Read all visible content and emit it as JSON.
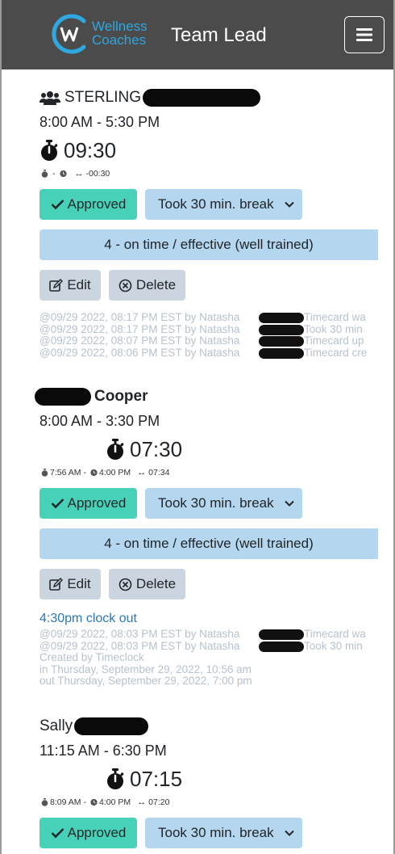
{
  "header": {
    "logo_line1": "Wellness",
    "logo_line2": "Coaches",
    "title": "Team Lead",
    "brand_color": "#2fa7e0",
    "menu_icon": "hamburger-icon"
  },
  "entries": [
    {
      "name": "STERLING",
      "name_icon": "users-icon",
      "shift": "8:00 AM - 5:30 PM",
      "duration": "09:30",
      "meta_in": "-",
      "meta_out": "",
      "meta_diff": "-00:30",
      "status": "Approved",
      "break_option": "Took 30 min. break",
      "rating": "4 - on time / effective (well trained)",
      "edit_label": "Edit",
      "delete_label": "Delete",
      "note": "",
      "log": [
        "@09/29 2022, 08:17 PM EST by Natasha",
        "@09/29 2022, 08:17 PM EST by Natasha",
        "@09/29 2022, 08:07 PM EST by Natasha",
        "@09/29 2022, 08:06 PM EST by Natasha"
      ],
      "log_tails": [
        "Timecard wa",
        "Took 30 min",
        "Timecard up",
        "Timecard cre"
      ]
    },
    {
      "name": "Cooper",
      "shift": "8:00 AM - 3:30 PM",
      "duration": "07:30",
      "meta_in": "7:56 AM",
      "meta_out": "4:00 PM",
      "meta_diff": "07:34",
      "status": "Approved",
      "break_option": "Took 30 min. break",
      "rating": "4 - on time / effective (well trained)",
      "edit_label": "Edit",
      "delete_label": "Delete",
      "note": "4:30pm clock out",
      "log": [
        "@09/29 2022, 08:03 PM EST by Natasha",
        "@09/29 2022, 08:03 PM EST by Natasha",
        "Created by Timeclock",
        "in  Thursday, September 29, 2022, 10:56 am",
        "out Thursday, September 29, 2022, 7:00 pm"
      ],
      "log_tails": [
        "Timecard wa",
        "Took 30 min"
      ]
    },
    {
      "name": "Sally",
      "shift": "11:15 AM - 6:30 PM",
      "duration": "07:15",
      "meta_in": "8:09 AM",
      "meta_out": "4:00 PM",
      "meta_diff": "07:20",
      "status": "Approved",
      "break_option": "Took 30 min. break"
    }
  ],
  "colors": {
    "approved": "#48d1b9",
    "select": "#b4d7ef",
    "secondary_button": "#cbd5df",
    "log_text": "#b6c2cd",
    "note_link": "#2c78b8",
    "topbar": "#4b4b4b"
  }
}
